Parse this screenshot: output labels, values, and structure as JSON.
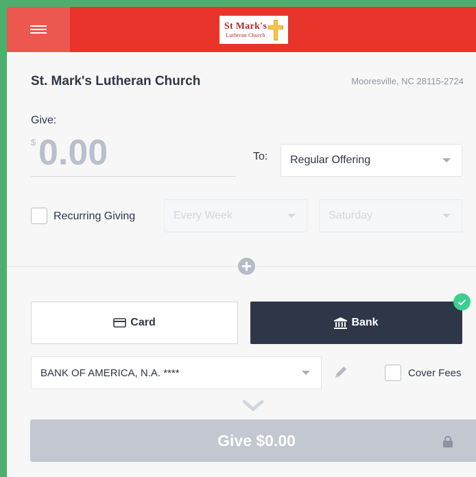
{
  "header": {
    "menu_icon": "hamburger-menu-icon",
    "logo": {
      "line1": "St Mark's",
      "line2": "Lutheran Church",
      "icon": "cross-icon"
    }
  },
  "church": {
    "name": "St. Mark's Lutheran Church",
    "location": "Mooresville, NC 28115-2724"
  },
  "give": {
    "label": "Give:",
    "currency_symbol": "$",
    "amount_placeholder": "0.00",
    "to_label": "To:",
    "fund": "Regular Offering"
  },
  "recurring": {
    "label": "Recurring Giving",
    "checked": false,
    "frequency": "Every Week",
    "day": "Saturday"
  },
  "payment": {
    "card_label": "Card",
    "bank_label": "Bank",
    "selected": "Bank",
    "account": "BANK OF AMERICA, N.A. ****",
    "cover_fees_label": "Cover Fees",
    "cover_fees_checked": false
  },
  "submit": {
    "label": "Give $0.00"
  },
  "colors": {
    "header_red": "#e8342b",
    "bank_selected": "#2e3748",
    "check_green": "#3ccf8e",
    "submit_disabled": "#c2c7d0"
  }
}
